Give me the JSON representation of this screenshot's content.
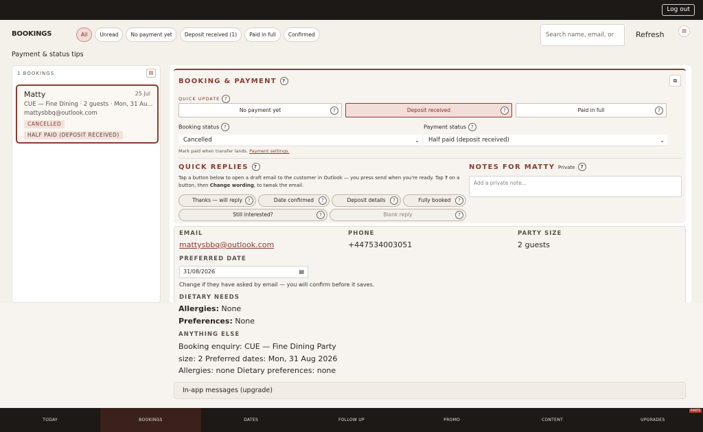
{
  "topbar": {
    "logout_label": "Log out"
  },
  "header": {
    "brand": "BOOKINGS",
    "filters": [
      "All",
      "Unread",
      "No payment yet",
      "Deposit received (1)",
      "Paid in full",
      "Confirmed"
    ],
    "search_placeholder": "Search name, email, or",
    "refresh_label": "Refresh",
    "tips_link": "Payment & status tips"
  },
  "sidebar": {
    "count_label": "1 BOOKINGS",
    "card": {
      "name": "Matty",
      "date": "25 Jul",
      "desc": "CUE — Fine Dining · 2 guests · Mon, 31 Au...",
      "email": "mattysbbq@outlook.com",
      "status_badge": "CANCELLED",
      "payment_badge": "HALF PAID (DEPOSIT RECEIVED)"
    }
  },
  "booking": {
    "title": "BOOKING & PAYMENT",
    "quick_update_label": "QUICK UPDATE",
    "quick_update": [
      "No payment yet",
      "Deposit received",
      "Paid in full"
    ],
    "booking_status_label": "Booking status",
    "booking_status_value": "Cancelled",
    "payment_status_label": "Payment status",
    "payment_status_value": "Half paid (deposit received)",
    "hint_text": "Mark paid when transfer lands.",
    "hint_link": "Payment settings."
  },
  "quick_replies": {
    "title": "QUICK REPLIES",
    "help_part1": "Tap a button below to open a draft email to the customer in Outlook — you press send when you're ready. Tap ",
    "help_q": "?",
    "help_part2": " on a button, then ",
    "help_bold": "Change wording",
    "help_part3": ", to tweak the email.",
    "row1": [
      "Thanks — will reply",
      "Date confirmed",
      "Deposit details",
      "Fully booked"
    ],
    "row2": [
      "Still interested?",
      "Blank reply"
    ]
  },
  "notes": {
    "title": "NOTES FOR MATTY",
    "private_label": "Private",
    "placeholder": "Add a private note..."
  },
  "details": {
    "email_label": "EMAIL",
    "email_value": "mattysbbq@outlook.com",
    "phone_label": "PHONE",
    "phone_value": "+447534003051",
    "party_label": "PARTY SIZE",
    "party_value": "2 guests",
    "pref_date_label": "PREFERRED DATE",
    "pref_date_value": "31/08/2026",
    "pref_date_hint": "Change if they have asked by email — you will confirm before it saves.",
    "dietary_label": "DIETARY NEEDS",
    "allergies_label": "Allergies:",
    "allergies_value": "None",
    "preferences_label": "Preferences:",
    "preferences_value": "None",
    "anything_label": "ANYTHING ELSE",
    "anything_line1": "Booking enquiry: CUE — Fine Dining Party",
    "anything_line2": "size: 2 Preferred dates: Mon, 31 Aug 2026",
    "anything_line3": "Allergies: none Dietary preferences: none"
  },
  "messages": {
    "label": "In-app messages (upgrade)"
  },
  "nav": [
    "TODAY",
    "BOOKINGS",
    "DATES",
    "FOLLOW UP",
    "PROMO",
    "CONTENT",
    "UPGRADES"
  ],
  "corner_tag": "P/ARTS",
  "colors": {
    "accent": "#8c3a30",
    "dark": "#1c1917",
    "background": "#f4f1ea"
  }
}
